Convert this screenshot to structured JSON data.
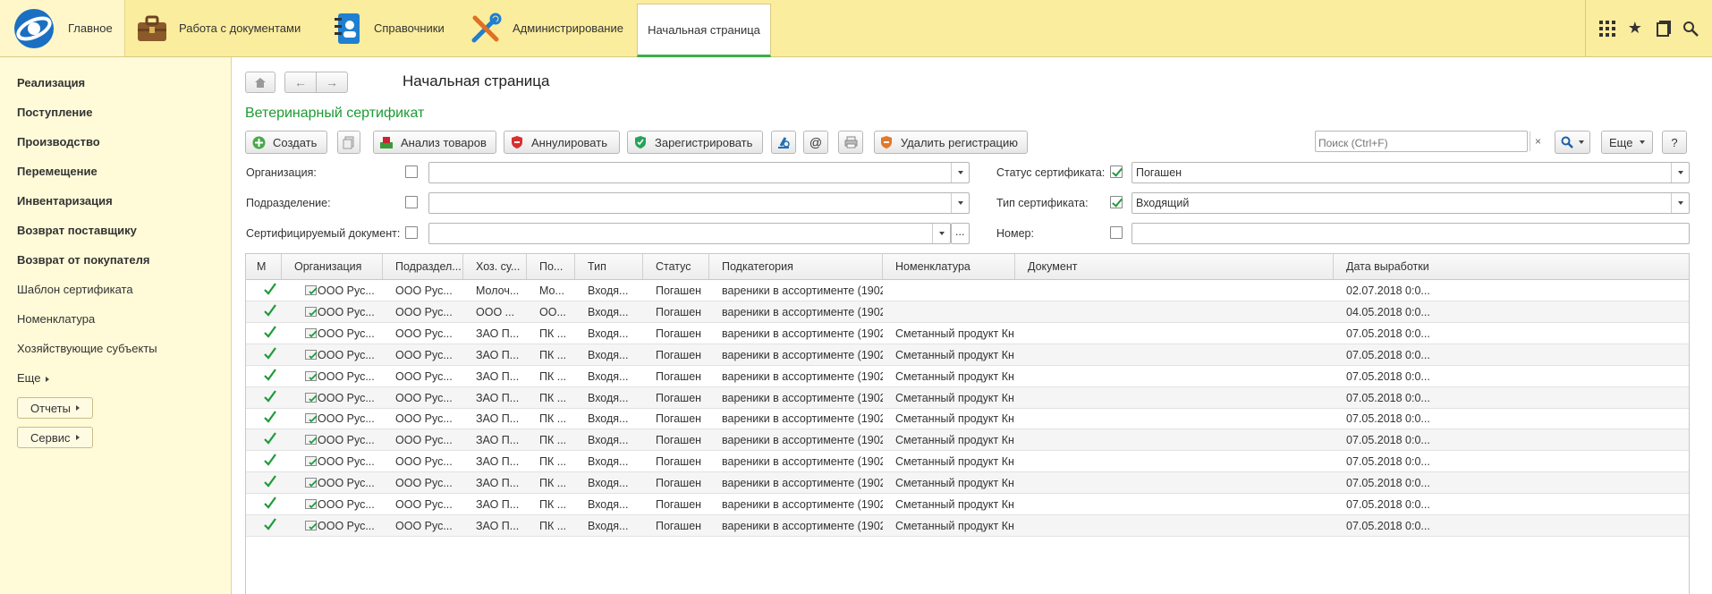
{
  "topbar": {
    "main_label": "Главное",
    "docs_label": "Работа с документами",
    "refs_label": "Справочники",
    "admin_label": "Администрирование",
    "home_tab": "Начальная страница",
    "accent": "#fbed9e"
  },
  "sidebar": {
    "items": [
      "Реализация",
      "Поступление",
      "Производство",
      "Перемещение",
      "Инвентаризация",
      "Возврат поставщику",
      "Возврат от покупателя",
      "Шаблон сертификата",
      "Номенклатура",
      "Хозяйствующие субъекты",
      "Еще"
    ],
    "reports_label": "Отчеты",
    "service_label": "Сервис"
  },
  "main": {
    "page_title": "Начальная страница",
    "form_title": "Ветеринарный сертификат",
    "toolbar": {
      "create": "Создать",
      "analysis": "Анализ товаров",
      "annul": "Аннулировать",
      "register": "Зарегистрировать",
      "delete_reg": "Удалить регистрацию",
      "at": "@",
      "search_placeholder": "Поиск (Ctrl+F)",
      "search_clear": "×",
      "more": "Еще",
      "help": "?"
    },
    "filters": {
      "org_label": "Организация:",
      "dept_label": "Подразделение:",
      "doc_label": "Сертифицируемый документ:",
      "doc_dots": "...",
      "status_label": "Статус сертификата:",
      "status_value": "Погашен",
      "type_label": "Тип сертификата:",
      "type_value": "Входящий",
      "number_label": "Номер:"
    }
  },
  "table": {
    "headers": [
      "М",
      "Организация",
      "Подраздел...",
      "Хоз. су...",
      "По...",
      "Тип",
      "Статус",
      "Подкатегория",
      "Номенклатура",
      "Документ",
      "Дата выработки"
    ],
    "rows": [
      [
        "ООО Рус...",
        "ООО Рус...",
        "Молоч...",
        "Мо...",
        "Входя...",
        "Погашен",
        "вареники в ассортименте (1902)",
        "",
        "",
        "02.07.2018 0:0..."
      ],
      [
        "ООО Рус...",
        "ООО Рус...",
        "ООО ...",
        "ОО...",
        "Входя...",
        "Погашен",
        "вареники в ассортименте (1902)",
        "",
        "",
        "04.05.2018 0:0..."
      ],
      [
        "ООО Рус...",
        "ООО Рус...",
        "ЗАО П...",
        "ПК ...",
        "Входя...",
        "Погашен",
        "вареники в ассортименте (1902)",
        "Сметанный продукт Кн...",
        "",
        "07.05.2018 0:0..."
      ],
      [
        "ООО Рус...",
        "ООО Рус...",
        "ЗАО П...",
        "ПК ...",
        "Входя...",
        "Погашен",
        "вареники в ассортименте (1902)",
        "Сметанный продукт Кн...",
        "",
        "07.05.2018 0:0..."
      ],
      [
        "ООО Рус...",
        "ООО Рус...",
        "ЗАО П...",
        "ПК ...",
        "Входя...",
        "Погашен",
        "вареники в ассортименте (1902)",
        "Сметанный продукт Кн...",
        "",
        "07.05.2018 0:0..."
      ],
      [
        "ООО Рус...",
        "ООО Рус...",
        "ЗАО П...",
        "ПК ...",
        "Входя...",
        "Погашен",
        "вареники в ассортименте (1902)",
        "Сметанный продукт Кн...",
        "",
        "07.05.2018 0:0..."
      ],
      [
        "ООО Рус...",
        "ООО Рус...",
        "ЗАО П...",
        "ПК ...",
        "Входя...",
        "Погашен",
        "вареники в ассортименте (1902)",
        "Сметанный продукт Кн...",
        "",
        "07.05.2018 0:0..."
      ],
      [
        "ООО Рус...",
        "ООО Рус...",
        "ЗАО П...",
        "ПК ...",
        "Входя...",
        "Погашен",
        "вареники в ассортименте (1902)",
        "Сметанный продукт Кн...",
        "",
        "07.05.2018 0:0..."
      ],
      [
        "ООО Рус...",
        "ООО Рус...",
        "ЗАО П...",
        "ПК ...",
        "Входя...",
        "Погашен",
        "вареники в ассортименте (1902)",
        "Сметанный продукт Кн...",
        "",
        "07.05.2018 0:0..."
      ],
      [
        "ООО Рус...",
        "ООО Рус...",
        "ЗАО П...",
        "ПК ...",
        "Входя...",
        "Погашен",
        "вареники в ассортименте (1902)",
        "Сметанный продукт Кн...",
        "",
        "07.05.2018 0:0..."
      ],
      [
        "ООО Рус...",
        "ООО Рус...",
        "ЗАО П...",
        "ПК ...",
        "Входя...",
        "Погашен",
        "вареники в ассортименте (1902)",
        "Сметанный продукт Кн...",
        "",
        "07.05.2018 0:0..."
      ],
      [
        "ООО Рус...",
        "ООО Рус...",
        "ЗАО П...",
        "ПК ...",
        "Входя...",
        "Погашен",
        "вареники в ассортименте (1902)",
        "Сметанный продукт Кн...",
        "",
        "07.05.2018 0:0..."
      ]
    ]
  }
}
